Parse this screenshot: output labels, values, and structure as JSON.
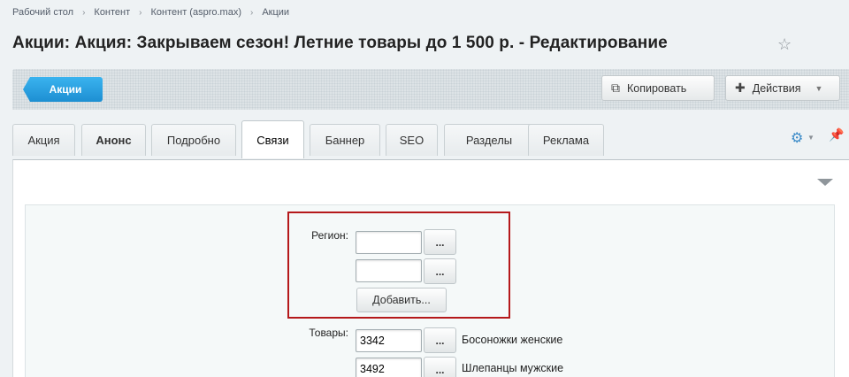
{
  "breadcrumb": [
    "Рабочий стол",
    "Контент",
    "Контент (aspro.max)",
    "Акции"
  ],
  "page_title": "Акции: Акция: Закрываем сезон! Летние товары до 1 500 р. - Редактирование",
  "toolbar": {
    "back_label": "Акции",
    "copy_label": "Копировать",
    "actions_label": "Действия"
  },
  "tabs": [
    "Акция",
    "Анонс",
    "Подробно",
    "Связи",
    "Баннер",
    "SEO",
    "Разделы",
    "Реклама"
  ],
  "active_tab": "Связи",
  "form": {
    "region_label": "Регион:",
    "region_inputs": [
      "",
      ""
    ],
    "browse_label": "...",
    "add_label": "Добавить...",
    "products_label": "Товары:",
    "products": [
      {
        "id": "3342",
        "name": "Босоножки женские"
      },
      {
        "id": "3492",
        "name": "Шлепанцы мужские"
      }
    ]
  },
  "icons": {
    "star": "star-icon",
    "copy": "copy-icon",
    "plus": "plus-icon",
    "gear": "gear-icon",
    "pin": "pin-icon"
  },
  "colors": {
    "accent": "#1d8fd2",
    "highlight_border": "#b5191b"
  }
}
